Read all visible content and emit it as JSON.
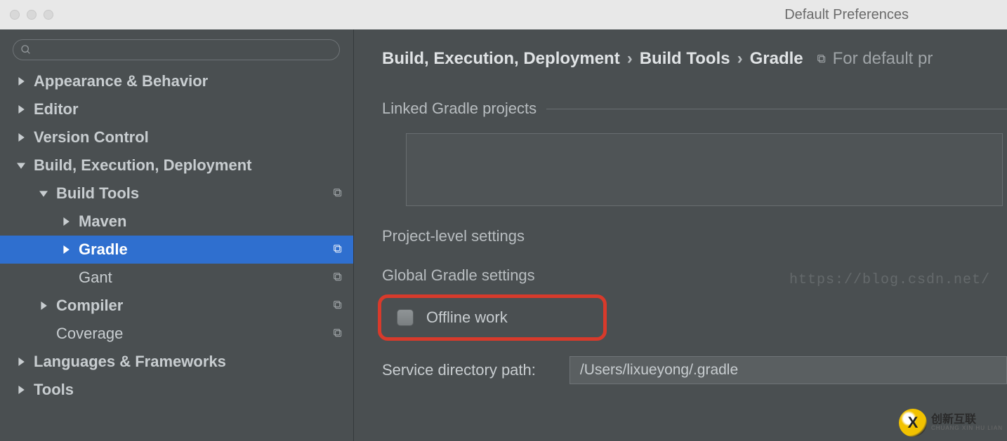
{
  "window": {
    "title": "Default Preferences"
  },
  "search": {
    "placeholder": ""
  },
  "tree": {
    "appearance": "Appearance & Behavior",
    "editor": "Editor",
    "vcs": "Version Control",
    "build": "Build, Execution, Deployment",
    "build_tools": "Build Tools",
    "maven": "Maven",
    "gradle": "Gradle",
    "gant": "Gant",
    "compiler": "Compiler",
    "coverage": "Coverage",
    "langfw": "Languages & Frameworks",
    "tools": "Tools"
  },
  "breadcrumb": {
    "a": "Build, Execution, Deployment",
    "b": "Build Tools",
    "c": "Gradle",
    "scope": "For default pr"
  },
  "sections": {
    "linked": "Linked Gradle projects",
    "project_level": "Project-level settings",
    "global": "Global Gradle settings"
  },
  "watermark": "https://blog.csdn.net/",
  "offline": {
    "label": "Offline work"
  },
  "service_dir": {
    "label": "Service directory path:",
    "value": "/Users/lixueyong/.gradle"
  },
  "logo": {
    "line1": "创新互联",
    "line2": "CHUANG XIN HU LIAN"
  },
  "colors": {
    "selection": "#2f6fcf",
    "highlight_border": "#d83a2b",
    "bg": "#4a4f51"
  }
}
